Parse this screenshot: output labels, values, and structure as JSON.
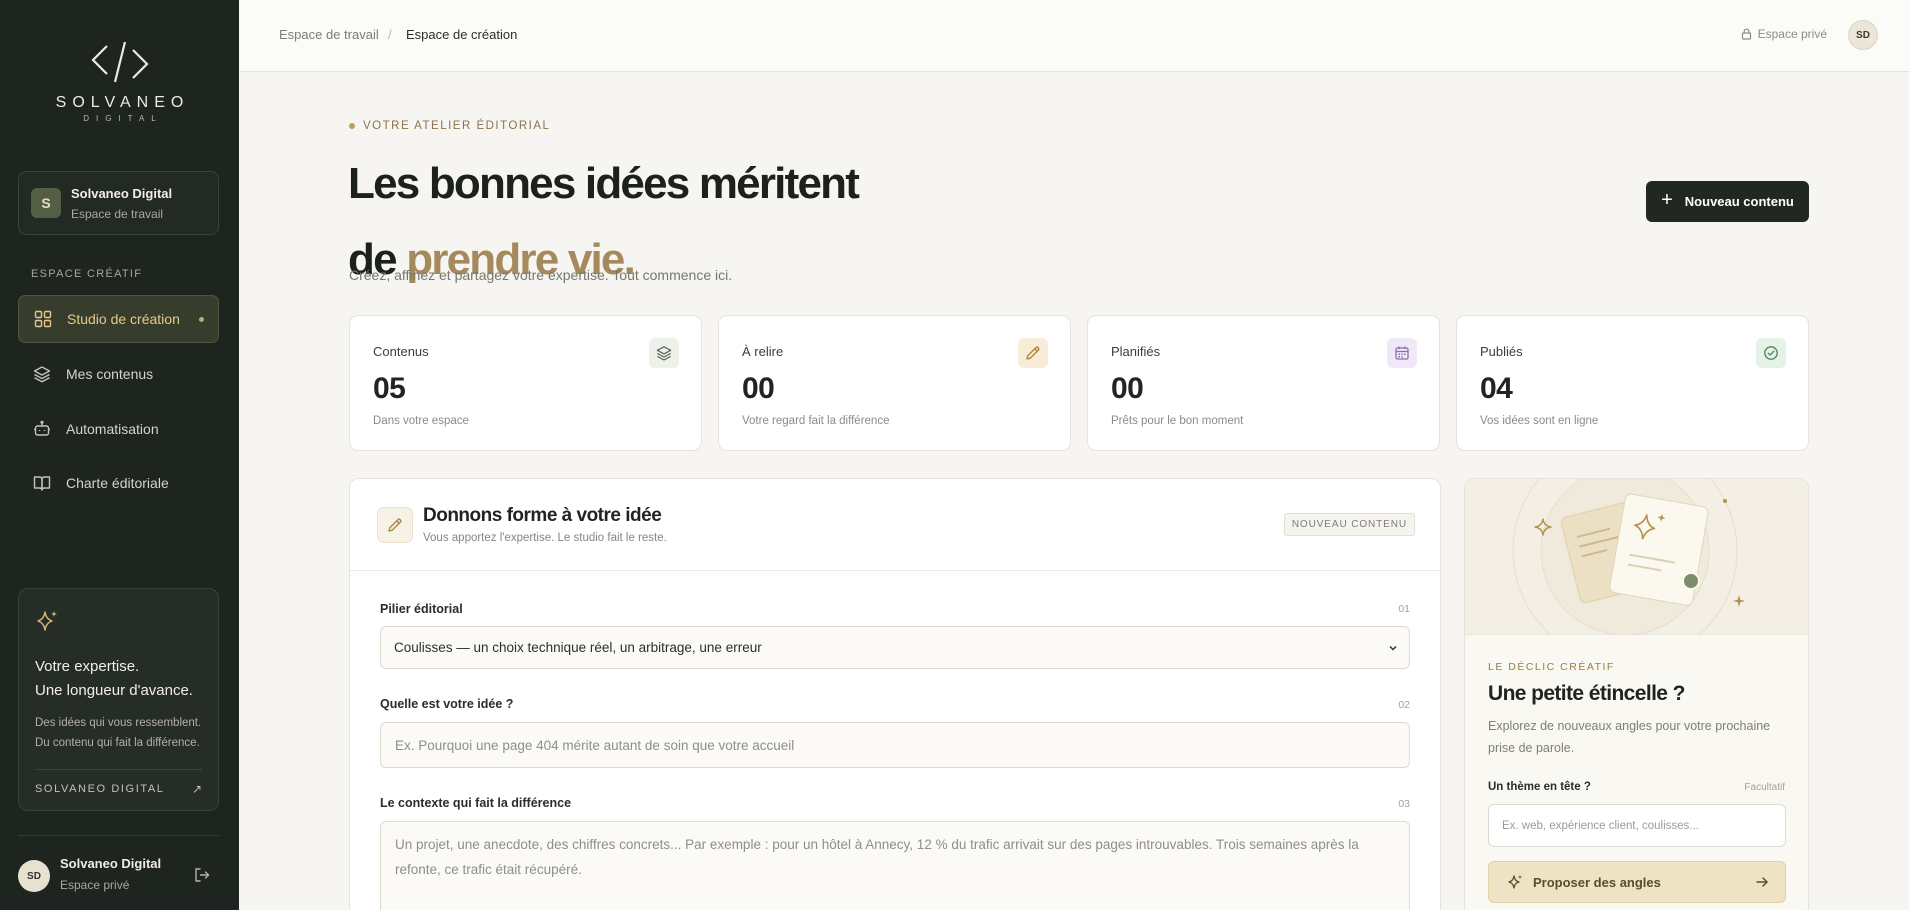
{
  "brand": {
    "name": "SOLVANEO",
    "subname": "DIGITAL"
  },
  "workspace": {
    "initial": "S",
    "title": "Solvaneo Digital",
    "subtitle": "Espace de travail"
  },
  "sidebar": {
    "section_label": "ESPACE CRÉATIF",
    "items": [
      {
        "label": "Studio de création",
        "icon": "grid-icon",
        "active": true
      },
      {
        "label": "Mes contenus",
        "icon": "layers-icon"
      },
      {
        "label": "Automatisation",
        "icon": "robot-icon"
      },
      {
        "label": "Charte éditoriale",
        "icon": "book-icon"
      }
    ],
    "promo": {
      "line1": "Votre expertise.",
      "line2": "Une longueur d'avance.",
      "text": "Des idées qui vous ressemblent. Du contenu qui fait la différence.",
      "brand": "SOLVANEO DIGITAL",
      "arrow": "↗"
    },
    "user": {
      "initials": "SD",
      "name": "Solvaneo Digital",
      "subtitle": "Espace privé"
    }
  },
  "topbar": {
    "breadcrumb": [
      "Espace de travail",
      "Espace de création"
    ],
    "separator": "/",
    "private_label": "Espace privé",
    "avatar": "SD"
  },
  "hero": {
    "eyebrow": "VOTRE ATELIER ÉDITORIAL",
    "title_line1": "Les bonnes idées méritent",
    "title_line2_prefix": "de ",
    "title_line2_accent": "prendre vie.",
    "subtitle": "Créez, affinez et partagez votre expertise. Tout commence ici.",
    "new_button": "Nouveau contenu"
  },
  "stats": [
    {
      "label": "Contenus",
      "value": "05",
      "desc": "Dans votre espace",
      "icon": "layers-icon",
      "color": "#eef0ea"
    },
    {
      "label": "À relire",
      "value": "00",
      "desc": "Votre regard fait la différence",
      "icon": "pencil-icon",
      "color": "#f8ecd8"
    },
    {
      "label": "Planifiés",
      "value": "00",
      "desc": "Prêts pour le bon moment",
      "icon": "calendar-icon",
      "color": "#efe9f6"
    },
    {
      "label": "Publiés",
      "value": "04",
      "desc": "Vos idées sont en ligne",
      "icon": "check-circle-icon",
      "color": "#e6f1e8"
    }
  ],
  "form": {
    "title": "Donnons forme à votre idée",
    "subtitle": "Vous apportez l'expertise. Le studio fait le reste.",
    "tag": "NOUVEAU CONTENU",
    "fields": [
      {
        "label": "Pilier éditorial",
        "num": "01",
        "value": "Coulisses — un choix technique réel, un arbitrage, une erreur"
      },
      {
        "label": "Quelle est votre idée ?",
        "num": "02",
        "placeholder": "Ex. Pourquoi une page 404 mérite autant de soin que votre accueil"
      },
      {
        "label": "Le contexte qui fait la différence",
        "num": "03",
        "placeholder": "Un projet, une anecdote, des chiffres concrets... Par exemple : pour un hôtel à Annecy, 12 % du trafic arrivait sur des pages introuvables. Trois semaines après la refonte, ce trafic était récupéré."
      }
    ]
  },
  "spark": {
    "eyebrow": "LE DÉCLIC CRÉATIF",
    "title": "Une petite étincelle ?",
    "desc": "Explorez de nouveaux angles pour votre prochaine prise de parole.",
    "theme_label": "Un thème en tête ?",
    "optional": "Facultatif",
    "placeholder": "Ex. web, expérience client, coulisses...",
    "button": "Proposer des angles"
  }
}
